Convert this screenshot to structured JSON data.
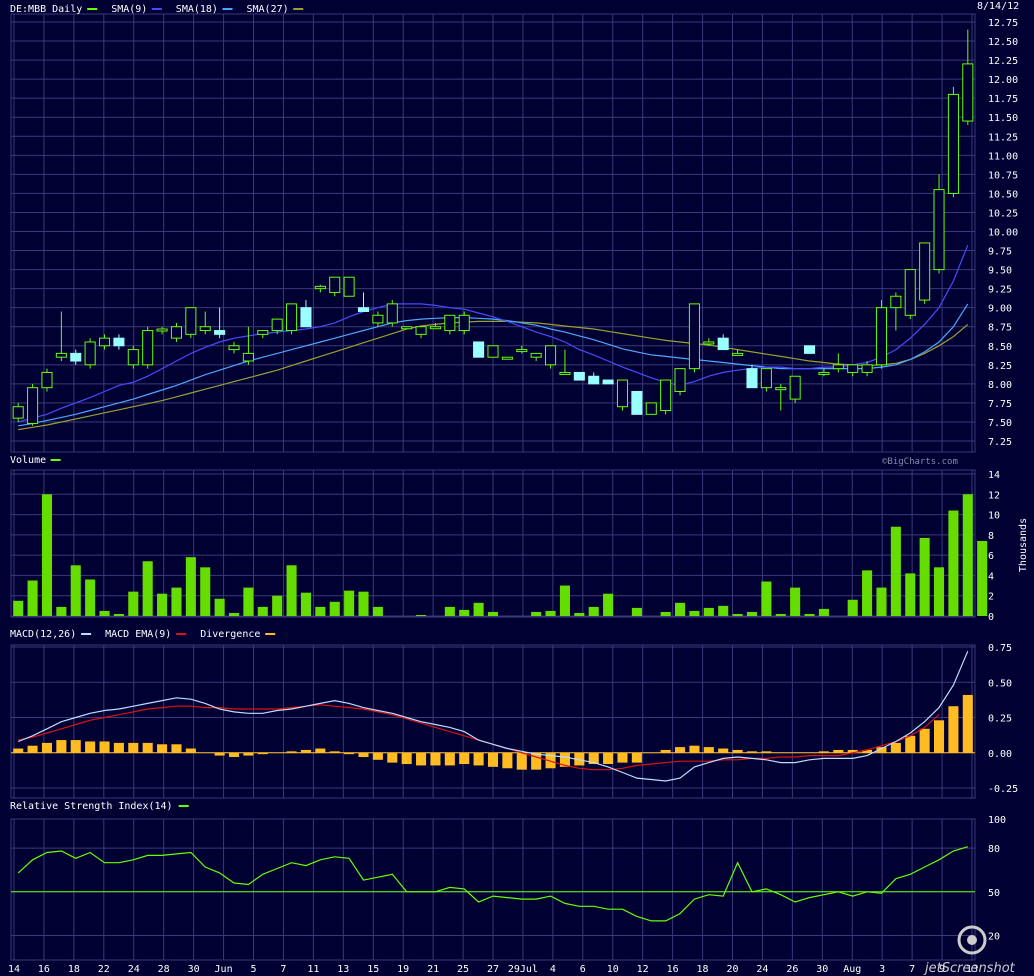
{
  "header": {
    "ticker": "DE:MBB Daily",
    "date": "8/14/12"
  },
  "watermark": "©BigCharts.com",
  "jet_logo": "jetScreenshot",
  "colors": {
    "background": "#000033",
    "grid": "#3a3a7a",
    "up": "#66ff00",
    "down": "#99ffff",
    "sma9": "#4a4aff",
    "sma18": "#4da6ff",
    "sma27": "#99a030",
    "volume": "#66dd00",
    "macd": "#bbddff",
    "macd_ema": "#dd1111",
    "divergence": "#ffbb22",
    "rsi": "#66ff00"
  },
  "x_labels": [
    "14",
    "16",
    "18",
    "22",
    "24",
    "28",
    "30",
    "Jun",
    "5",
    "7",
    "11",
    "13",
    "15",
    "19",
    "21",
    "25",
    "27",
    "29Jul",
    "4",
    "6",
    "10",
    "12",
    "16",
    "18",
    "20",
    "24",
    "26",
    "30",
    "Aug",
    "3",
    "7",
    "9",
    "13"
  ],
  "chart_data": [
    {
      "type": "candlestick",
      "legend": [
        {
          "name": "DE:MBB Daily",
          "color": "#66ff00"
        },
        {
          "name": "SMA(9)",
          "color": "#4a4aff"
        },
        {
          "name": "SMA(18)",
          "color": "#4da6ff"
        },
        {
          "name": "SMA(27)",
          "color": "#99a030"
        }
      ],
      "ylim": [
        7.25,
        12.75
      ],
      "yticks": [
        "7.25",
        "7.50",
        "7.75",
        "8.00",
        "8.25",
        "8.50",
        "8.75",
        "9.00",
        "9.25",
        "9.50",
        "9.75",
        "10.00",
        "10.25",
        "10.50",
        "10.75",
        "11.00",
        "11.25",
        "11.50",
        "11.75",
        "12.00",
        "12.25",
        "12.50",
        "12.75"
      ],
      "ohlc": [
        [
          7.55,
          7.75,
          7.5,
          7.7
        ],
        [
          7.48,
          8.0,
          7.45,
          7.95
        ],
        [
          7.95,
          8.2,
          7.9,
          8.15
        ],
        [
          8.35,
          8.95,
          8.3,
          8.4
        ],
        [
          8.4,
          8.45,
          8.25,
          8.3
        ],
        [
          8.25,
          8.6,
          8.2,
          8.55
        ],
        [
          8.5,
          8.65,
          8.45,
          8.6
        ],
        [
          8.6,
          8.65,
          8.45,
          8.5
        ],
        [
          8.25,
          8.5,
          8.2,
          8.45
        ],
        [
          8.25,
          8.75,
          8.2,
          8.7
        ],
        [
          8.7,
          8.75,
          8.65,
          8.72
        ],
        [
          8.6,
          8.8,
          8.55,
          8.75
        ],
        [
          8.65,
          9.0,
          8.6,
          9.0
        ],
        [
          8.7,
          8.95,
          8.65,
          8.75
        ],
        [
          8.7,
          9.0,
          8.6,
          8.65
        ],
        [
          8.45,
          8.55,
          8.4,
          8.5
        ],
        [
          8.3,
          8.75,
          8.25,
          8.4
        ],
        [
          8.65,
          8.7,
          8.6,
          8.7
        ],
        [
          8.7,
          8.85,
          8.65,
          8.85
        ],
        [
          8.7,
          9.05,
          8.65,
          9.05
        ],
        [
          9.0,
          9.1,
          8.9,
          8.75
        ],
        [
          9.25,
          9.3,
          9.2,
          9.28
        ],
        [
          9.2,
          9.4,
          9.15,
          9.4
        ],
        [
          9.15,
          9.4,
          9.15,
          9.4
        ],
        [
          9.0,
          9.2,
          8.95,
          8.95
        ],
        [
          8.8,
          8.95,
          8.75,
          8.9
        ],
        [
          8.8,
          9.1,
          8.75,
          9.05
        ],
        [
          8.75,
          8.75,
          8.75,
          8.75
        ],
        [
          8.65,
          8.75,
          8.6,
          8.75
        ],
        [
          8.75,
          8.8,
          8.75,
          8.75
        ],
        [
          8.7,
          8.9,
          8.65,
          8.9
        ],
        [
          8.7,
          8.95,
          8.65,
          8.9
        ],
        [
          8.55,
          8.55,
          8.35,
          8.35
        ],
        [
          8.35,
          8.5,
          8.35,
          8.5
        ],
        [
          8.35,
          8.35,
          8.35,
          8.35
        ],
        [
          8.45,
          8.5,
          8.4,
          8.45
        ],
        [
          8.35,
          8.4,
          8.3,
          8.4
        ],
        [
          8.25,
          8.5,
          8.2,
          8.5
        ],
        [
          8.15,
          8.45,
          8.15,
          8.15
        ],
        [
          8.15,
          8.15,
          8.05,
          8.05
        ],
        [
          8.1,
          8.15,
          8.0,
          8.0
        ],
        [
          8.05,
          8.05,
          8.0,
          8.0
        ],
        [
          7.7,
          8.05,
          7.65,
          8.05
        ],
        [
          7.9,
          7.9,
          7.6,
          7.6
        ],
        [
          7.6,
          7.75,
          7.6,
          7.75
        ],
        [
          7.65,
          8.05,
          7.6,
          8.05
        ],
        [
          7.9,
          8.2,
          7.85,
          8.2
        ],
        [
          8.2,
          9.05,
          8.15,
          9.05
        ],
        [
          8.55,
          8.6,
          8.5,
          8.55
        ],
        [
          8.6,
          8.65,
          8.45,
          8.45
        ],
        [
          8.4,
          8.45,
          8.4,
          8.4
        ],
        [
          8.2,
          8.25,
          7.95,
          7.95
        ],
        [
          7.95,
          8.2,
          7.9,
          8.2
        ],
        [
          7.95,
          8.0,
          7.65,
          7.95
        ],
        [
          7.8,
          8.1,
          7.75,
          8.1
        ],
        [
          8.5,
          8.5,
          8.4,
          8.4
        ],
        [
          8.15,
          8.2,
          8.1,
          8.15
        ],
        [
          8.2,
          8.4,
          8.15,
          8.25
        ],
        [
          8.15,
          8.25,
          8.1,
          8.25
        ],
        [
          8.15,
          8.3,
          8.1,
          8.25
        ],
        [
          8.25,
          9.1,
          8.2,
          9.0
        ],
        [
          9.0,
          9.2,
          8.7,
          9.15
        ],
        [
          8.9,
          9.5,
          8.85,
          9.5
        ],
        [
          9.1,
          9.85,
          9.05,
          9.85
        ],
        [
          9.5,
          10.75,
          9.45,
          10.55
        ],
        [
          10.5,
          11.9,
          10.45,
          11.8
        ],
        [
          11.45,
          12.65,
          11.4,
          12.2
        ]
      ],
      "sma9": [
        7.5,
        7.55,
        7.6,
        7.68,
        7.75,
        7.82,
        7.9,
        7.98,
        8.02,
        8.1,
        8.2,
        8.3,
        8.4,
        8.48,
        8.55,
        8.6,
        8.63,
        8.66,
        8.68,
        8.7,
        8.72,
        8.75,
        8.8,
        8.88,
        8.95,
        9.0,
        9.05,
        9.05,
        9.05,
        9.03,
        9.0,
        8.98,
        8.93,
        8.88,
        8.82,
        8.75,
        8.68,
        8.62,
        8.55,
        8.45,
        8.38,
        8.3,
        8.22,
        8.15,
        8.08,
        8.02,
        7.98,
        8.03,
        8.1,
        8.15,
        8.18,
        8.2,
        8.22,
        8.22,
        8.2,
        8.2,
        8.22,
        8.22,
        8.25,
        8.28,
        8.35,
        8.45,
        8.6,
        8.78,
        9.0,
        9.35,
        9.82
      ],
      "sma18": [
        7.45,
        7.48,
        7.52,
        7.56,
        7.6,
        7.65,
        7.7,
        7.75,
        7.8,
        7.86,
        7.92,
        7.98,
        8.05,
        8.12,
        8.18,
        8.24,
        8.3,
        8.35,
        8.4,
        8.45,
        8.5,
        8.55,
        8.6,
        8.65,
        8.7,
        8.75,
        8.8,
        8.83,
        8.85,
        8.86,
        8.87,
        8.87,
        8.86,
        8.85,
        8.83,
        8.8,
        8.77,
        8.72,
        8.68,
        8.63,
        8.58,
        8.52,
        8.46,
        8.42,
        8.38,
        8.36,
        8.34,
        8.32,
        8.3,
        8.28,
        8.26,
        8.24,
        8.22,
        8.2,
        8.2,
        8.2,
        8.2,
        8.2,
        8.2,
        8.2,
        8.22,
        8.25,
        8.32,
        8.42,
        8.55,
        8.75,
        9.05
      ],
      "sma27": [
        7.4,
        7.43,
        7.46,
        7.5,
        7.54,
        7.58,
        7.62,
        7.66,
        7.7,
        7.74,
        7.78,
        7.83,
        7.88,
        7.93,
        7.98,
        8.03,
        8.08,
        8.13,
        8.18,
        8.24,
        8.3,
        8.36,
        8.42,
        8.48,
        8.54,
        8.6,
        8.66,
        8.72,
        8.76,
        8.78,
        8.8,
        8.81,
        8.82,
        8.82,
        8.82,
        8.81,
        8.8,
        8.78,
        8.76,
        8.74,
        8.72,
        8.69,
        8.66,
        8.63,
        8.6,
        8.57,
        8.55,
        8.53,
        8.51,
        8.48,
        8.45,
        8.42,
        8.39,
        8.36,
        8.33,
        8.3,
        8.28,
        8.26,
        8.25,
        8.24,
        8.25,
        8.27,
        8.32,
        8.4,
        8.5,
        8.62,
        8.78
      ]
    },
    {
      "type": "bar",
      "legend": [
        {
          "name": "Volume",
          "color": "#66ff00"
        }
      ],
      "ylabel": "Thousands",
      "ylim": [
        0,
        14
      ],
      "yticks": [
        "0",
        "2",
        "4",
        "6",
        "8",
        "10",
        "12",
        "14"
      ],
      "values": [
        1.5,
        3.5,
        12,
        0.9,
        5,
        3.6,
        0.5,
        0.2,
        2.4,
        5.4,
        2.2,
        2.8,
        5.8,
        4.8,
        1.7,
        0.3,
        2.8,
        0.9,
        2.0,
        5.0,
        2.3,
        0.9,
        1.4,
        2.5,
        2.4,
        0.9,
        0,
        0,
        0.1,
        0,
        0.9,
        0.6,
        1.3,
        0.4,
        0,
        0,
        0.4,
        0.5,
        3.0,
        0.3,
        0.9,
        2.2,
        0,
        0.8,
        0,
        0.4,
        1.3,
        0.5,
        0.8,
        1.0,
        0.2,
        0.4,
        3.4,
        0.2,
        2.8,
        0.2,
        0.7,
        0,
        1.6,
        4.5,
        2.8,
        8.8,
        4.2,
        7.7,
        4.8,
        10.4,
        12,
        7.4
      ]
    },
    {
      "type": "line",
      "legend": [
        {
          "name": "MACD(12,26)",
          "color": "#bbddff"
        },
        {
          "name": "MACD EMA(9)",
          "color": "#dd1111"
        },
        {
          "name": "Divergence",
          "color": "#ffbb22"
        }
      ],
      "ylim": [
        -0.25,
        0.75
      ],
      "yticks": [
        "-0.25",
        "0.00",
        "0.25",
        "0.50",
        "0.75"
      ],
      "macd": [
        0.08,
        0.12,
        0.17,
        0.22,
        0.25,
        0.28,
        0.3,
        0.31,
        0.33,
        0.35,
        0.37,
        0.39,
        0.38,
        0.35,
        0.31,
        0.29,
        0.28,
        0.28,
        0.3,
        0.31,
        0.33,
        0.35,
        0.37,
        0.35,
        0.32,
        0.3,
        0.28,
        0.25,
        0.22,
        0.2,
        0.18,
        0.15,
        0.09,
        0.06,
        0.03,
        0.01,
        -0.01,
        -0.02,
        -0.03,
        -0.05,
        -0.07,
        -0.1,
        -0.14,
        -0.18,
        -0.19,
        -0.2,
        -0.18,
        -0.1,
        -0.07,
        -0.04,
        -0.03,
        -0.04,
        -0.05,
        -0.07,
        -0.07,
        -0.05,
        -0.04,
        -0.04,
        -0.04,
        -0.02,
        0.03,
        0.08,
        0.14,
        0.22,
        0.32,
        0.48,
        0.72
      ],
      "ema": [
        0.09,
        0.11,
        0.14,
        0.17,
        0.2,
        0.23,
        0.25,
        0.27,
        0.29,
        0.31,
        0.32,
        0.33,
        0.33,
        0.32,
        0.32,
        0.31,
        0.31,
        0.31,
        0.31,
        0.32,
        0.33,
        0.34,
        0.33,
        0.32,
        0.31,
        0.29,
        0.27,
        0.24,
        0.21,
        0.18,
        0.15,
        0.12,
        0.09,
        0.06,
        0.03,
        0.0,
        -0.03,
        -0.06,
        -0.09,
        -0.11,
        -0.12,
        -0.12,
        -0.11,
        -0.09,
        -0.08,
        -0.07,
        -0.06,
        -0.06,
        -0.06,
        -0.05,
        -0.05,
        -0.04,
        -0.04,
        -0.03,
        -0.03,
        -0.02,
        -0.02,
        -0.02,
        0.0,
        0.02,
        0.05,
        0.08,
        0.12,
        0.18,
        0.27
      ],
      "divergence": [
        0.03,
        0.05,
        0.07,
        0.09,
        0.09,
        0.08,
        0.08,
        0.07,
        0.07,
        0.07,
        0.06,
        0.06,
        0.03,
        0.0,
        -0.02,
        -0.03,
        -0.02,
        -0.01,
        0.0,
        0.01,
        0.02,
        0.03,
        0.01,
        -0.01,
        -0.03,
        -0.05,
        -0.07,
        -0.08,
        -0.09,
        -0.09,
        -0.09,
        -0.08,
        -0.09,
        -0.1,
        -0.11,
        -0.12,
        -0.12,
        -0.11,
        -0.1,
        -0.09,
        -0.08,
        -0.08,
        -0.07,
        -0.07,
        0.0,
        0.02,
        0.04,
        0.05,
        0.04,
        0.03,
        0.02,
        0.01,
        0.01,
        0.0,
        0.0,
        0.0,
        0.01,
        0.02,
        0.02,
        0.02,
        0.04,
        0.07,
        0.12,
        0.17,
        0.23,
        0.33,
        0.41
      ]
    },
    {
      "type": "line",
      "legend": [
        {
          "name": "Relative Strength Index(14)",
          "color": "#66ff00"
        }
      ],
      "ylim": [
        0,
        100
      ],
      "yticks": [
        "20",
        "50",
        "80",
        "100"
      ],
      "refline": 50,
      "values": [
        63,
        72,
        77,
        78,
        73,
        77,
        70,
        70,
        72,
        75,
        75,
        76,
        77,
        67,
        63,
        56,
        55,
        62,
        66,
        70,
        68,
        72,
        74,
        73,
        58,
        60,
        62,
        50,
        50,
        50,
        53,
        52,
        43,
        47,
        46,
        45,
        45,
        47,
        42,
        40,
        40,
        38,
        38,
        33,
        30,
        30,
        35,
        45,
        48,
        47,
        70,
        50,
        52,
        48,
        43,
        46,
        48,
        50,
        47,
        50,
        49,
        59,
        62,
        67,
        72,
        78,
        81
      ]
    }
  ]
}
